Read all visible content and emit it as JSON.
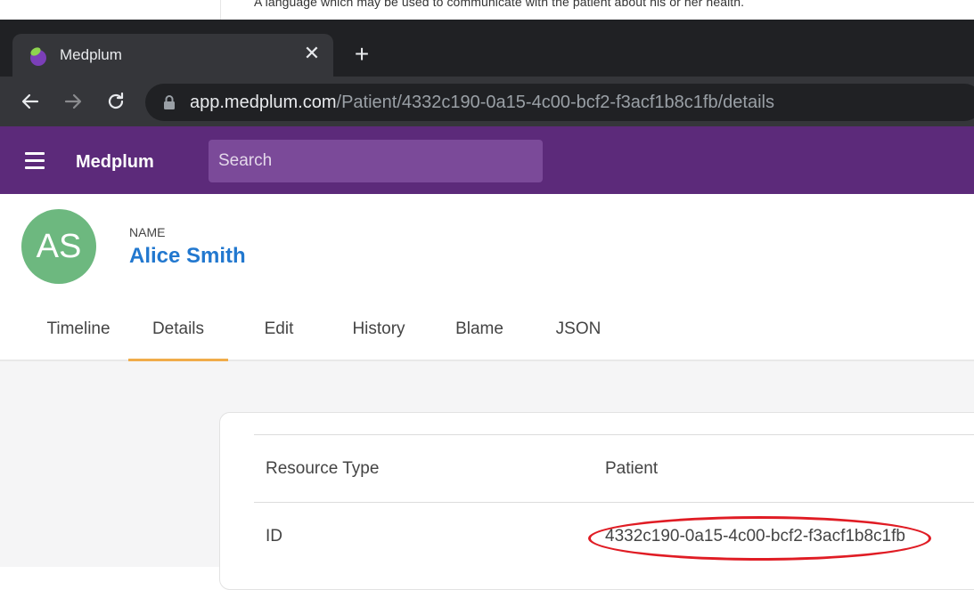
{
  "background_page": {
    "text": "A language which may be used to communicate with the patient about his or her health."
  },
  "browser": {
    "tab_title": "Medplum",
    "tab_favicon": "plum-icon",
    "close_glyph": "✕",
    "new_tab_glyph": "+",
    "url_host": "app.medplum.com",
    "url_path": "/Patient/4332c190-0a15-4c00-bcf2-f3acf1b8c1fb/details"
  },
  "app_header": {
    "brand": "Medplum",
    "search_placeholder": "Search",
    "accent_color": "#5c2a7a"
  },
  "patient": {
    "initials": "AS",
    "name_label": "NAME",
    "name": "Alice Smith",
    "avatar_color": "#6db87f"
  },
  "tabs": [
    {
      "label": "Timeline",
      "active": false
    },
    {
      "label": "Details",
      "active": true
    },
    {
      "label": "Edit",
      "active": false
    },
    {
      "label": "History",
      "active": false
    },
    {
      "label": "Blame",
      "active": false
    },
    {
      "label": "JSON",
      "active": false
    }
  ],
  "details": {
    "rows": [
      {
        "key": "Resource Type",
        "value": "Patient"
      },
      {
        "key": "ID",
        "value": "4332c190-0a15-4c00-bcf2-f3acf1b8c1fb"
      }
    ]
  },
  "annotation": {
    "color": "#e01c24"
  }
}
